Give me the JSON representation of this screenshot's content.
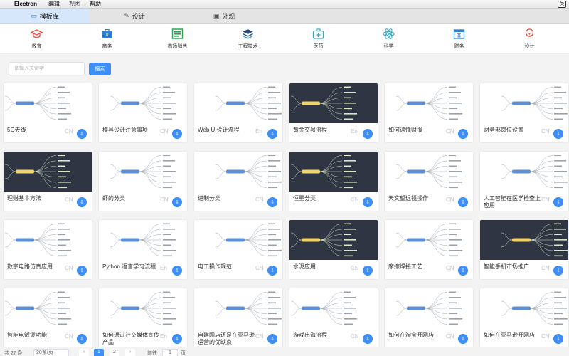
{
  "menubar": {
    "app": "Electron",
    "items": [
      "编辑",
      "视图",
      "帮助"
    ],
    "ime": "英"
  },
  "tabs": [
    {
      "label": "模板库",
      "icon": "folder-icon"
    },
    {
      "label": "设计",
      "icon": "edit-icon"
    },
    {
      "label": "外观",
      "icon": "briefcase-icon"
    }
  ],
  "categories": [
    {
      "label": "教育",
      "color": "#e74c3c"
    },
    {
      "label": "商务",
      "color": "#2d7fd3"
    },
    {
      "label": "市场销售",
      "color": "#27a34a"
    },
    {
      "label": "工程技术",
      "color": "#2c4a7a"
    },
    {
      "label": "医药",
      "color": "#3aa9c8"
    },
    {
      "label": "科学",
      "color": "#3aa9c8"
    },
    {
      "label": "财务",
      "color": "#2d7fd3"
    },
    {
      "label": "设计",
      "color": "#e74c3c"
    }
  ],
  "search": {
    "placeholder": "请输入关键字",
    "button": "搜索"
  },
  "cards": [
    {
      "title": "5G天线",
      "lang": "CN",
      "dark": false
    },
    {
      "title": "模具设计注意事项",
      "lang": "CN",
      "dark": false
    },
    {
      "title": "Web UI设计流程",
      "lang": "En",
      "dark": false
    },
    {
      "title": "黄金交易流程",
      "lang": "En",
      "dark": true
    },
    {
      "title": "如何读懂财报",
      "lang": "CN",
      "dark": false
    },
    {
      "title": "财务部岗位设置",
      "lang": "CN",
      "dark": false
    },
    {
      "title": "理财基本方法",
      "lang": "CN",
      "dark": true
    },
    {
      "title": "虾的分类",
      "lang": "CN",
      "dark": false
    },
    {
      "title": "进制分类",
      "lang": "CN",
      "dark": false
    },
    {
      "title": "恒星分类",
      "lang": "CN",
      "dark": true
    },
    {
      "title": "天文望远镜操作",
      "lang": "CN",
      "dark": false
    },
    {
      "title": "人工智能在医学检查上应用",
      "lang": "CN",
      "dark": false
    },
    {
      "title": "数字电路仿真应用",
      "lang": "CN",
      "dark": false
    },
    {
      "title": "Python 语言学习流程",
      "lang": "En",
      "dark": false
    },
    {
      "title": "电工操作规范",
      "lang": "CN",
      "dark": false
    },
    {
      "title": "水泥应用",
      "lang": "CN",
      "dark": true
    },
    {
      "title": "摩擦焊接工艺",
      "lang": "CN",
      "dark": false
    },
    {
      "title": "智能手机市场推广",
      "lang": "CN",
      "dark": true
    },
    {
      "title": "智能电饭煲功能",
      "lang": "CN",
      "dark": false
    },
    {
      "title": "如何通过社交媒体宣传产品",
      "lang": "En",
      "dark": false
    },
    {
      "title": "自建网店还是在亚马逊运营的优缺点",
      "lang": "CN",
      "dark": false
    },
    {
      "title": "游戏出海流程",
      "lang": "CN",
      "dark": false
    },
    {
      "title": "如何在淘宝开网店",
      "lang": "CN",
      "dark": false
    },
    {
      "title": "如何在亚马逊开网店",
      "lang": "CN",
      "dark": false
    }
  ],
  "download_icon": "⇩",
  "pagination": {
    "total": "共 27 条",
    "page_size": "20条/页",
    "pages": [
      "1",
      "2"
    ],
    "current": "1",
    "goto_label": "前往",
    "goto_value": "1",
    "goto_unit": "页"
  }
}
